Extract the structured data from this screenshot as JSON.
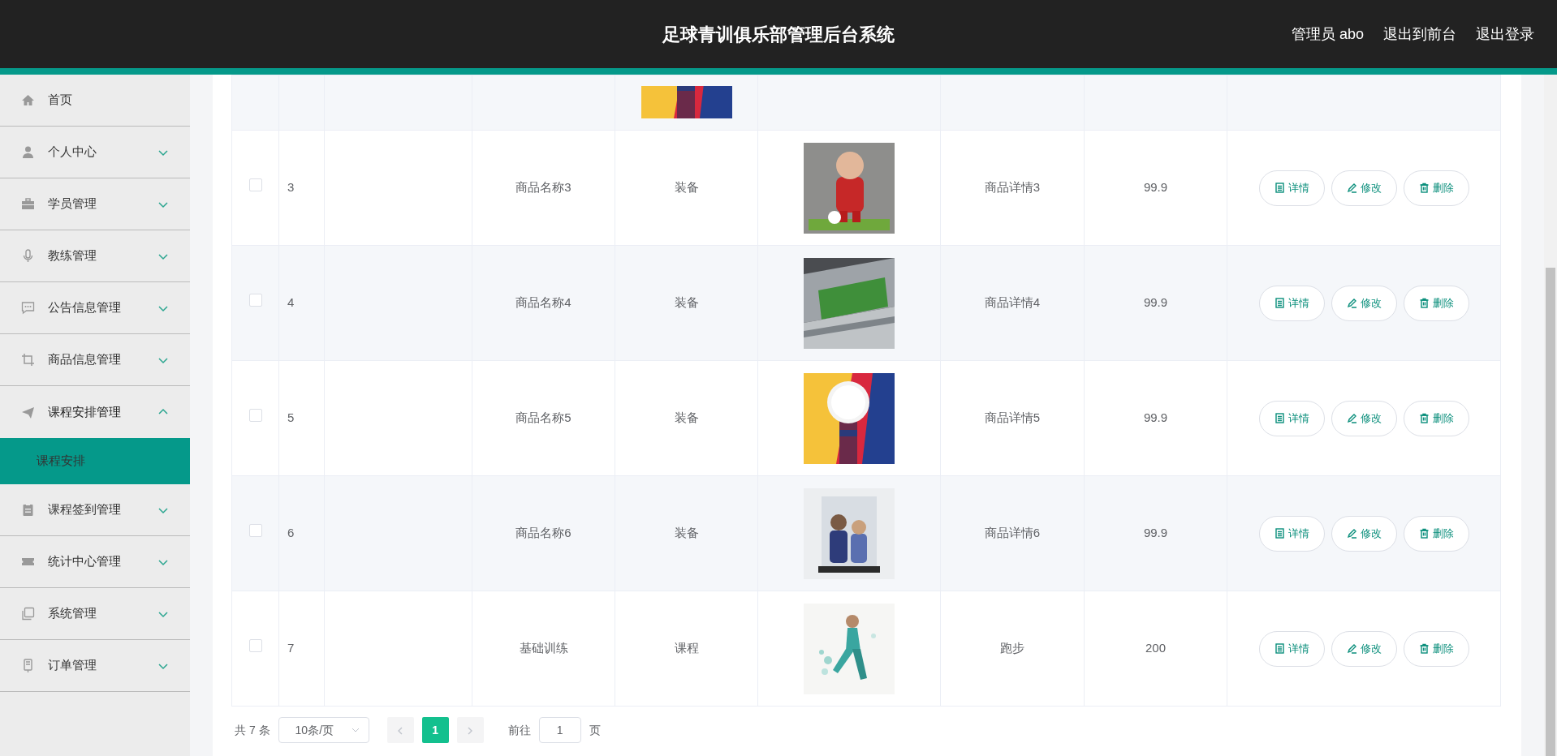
{
  "header": {
    "title": "足球青训俱乐部管理后台系统",
    "links": [
      "管理员 abo",
      "退出到前台",
      "退出登录"
    ]
  },
  "sidebar": {
    "items": [
      {
        "label": "首页",
        "kind": "link"
      },
      {
        "label": "个人中心",
        "kind": "menu",
        "expanded": false
      },
      {
        "label": "学员管理",
        "kind": "menu",
        "expanded": false
      },
      {
        "label": "教练管理",
        "kind": "menu",
        "expanded": false
      },
      {
        "label": "公告信息管理",
        "kind": "menu",
        "expanded": false
      },
      {
        "label": "商品信息管理",
        "kind": "menu",
        "expanded": false
      },
      {
        "label": "课程安排管理",
        "kind": "menu",
        "expanded": true,
        "children": [
          {
            "label": "课程安排",
            "selected": true
          }
        ]
      },
      {
        "label": "课程签到管理",
        "kind": "menu",
        "expanded": false
      },
      {
        "label": "统计中心管理",
        "kind": "menu",
        "expanded": false
      },
      {
        "label": "系统管理",
        "kind": "menu",
        "expanded": false
      },
      {
        "label": "订单管理",
        "kind": "menu",
        "expanded": false
      }
    ]
  },
  "table": {
    "rows": [
      {
        "checked": false,
        "index": "3",
        "name": "商品名称3",
        "category": "装备",
        "detail": "商品详情3",
        "price": "99.9",
        "actions": [
          "详情",
          "修改",
          "删除"
        ]
      },
      {
        "checked": false,
        "index": "4",
        "name": "商品名称4",
        "category": "装备",
        "detail": "商品详情4",
        "price": "99.9",
        "actions": [
          "详情",
          "修改",
          "删除"
        ]
      },
      {
        "checked": false,
        "index": "5",
        "name": "商品名称5",
        "category": "装备",
        "detail": "商品详情5",
        "price": "99.9",
        "actions": [
          "详情",
          "修改",
          "删除"
        ]
      },
      {
        "checked": false,
        "index": "6",
        "name": "商品名称6",
        "category": "装备",
        "detail": "商品详情6",
        "price": "99.9",
        "actions": [
          "详情",
          "修改",
          "删除"
        ]
      },
      {
        "checked": false,
        "index": "7",
        "name": "基础训练",
        "category": "课程",
        "detail": "跑步",
        "price": "200",
        "actions": [
          "详情",
          "修改",
          "删除"
        ]
      }
    ]
  },
  "pagination": {
    "total": "共 7 条",
    "page_size": "10条/页",
    "pages": [
      {
        "label": "1",
        "selected": true
      }
    ],
    "goto_label": "前往",
    "goto_value": "1",
    "goto_suffix": "页"
  }
}
